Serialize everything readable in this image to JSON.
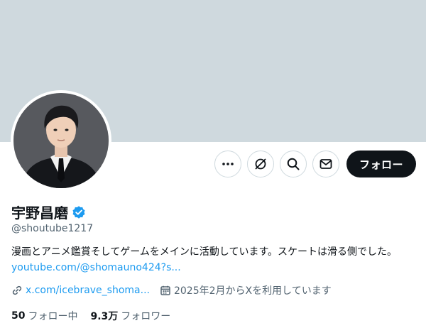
{
  "profile": {
    "display_name": "宇野昌磨",
    "handle": "@shoutube1217",
    "verified": true,
    "bio_text": "漫画とアニメ鑑賞そしてゲームをメインに活動しています。スケートは滑る側でした。",
    "bio_link": "youtube.com/@shomauno424?s...",
    "website": "x.com/icebrave_shoma...",
    "joined": "2025年2月からXを利用しています",
    "following_count": "50",
    "following_label": "フォロー中",
    "followers_count": "9.3万",
    "followers_label": "フォロワー"
  },
  "actions": {
    "follow_label": "フォロー"
  },
  "icons": [
    "more-icon",
    "grok-icon",
    "search-icon",
    "message-icon",
    "verified-badge-icon",
    "link-icon",
    "calendar-icon"
  ],
  "colors": {
    "banner": "#cfd9de",
    "accent": "#1d9bf0",
    "primary_text": "#0f1419",
    "secondary_text": "#536471",
    "follow_button": "#0f1419"
  }
}
